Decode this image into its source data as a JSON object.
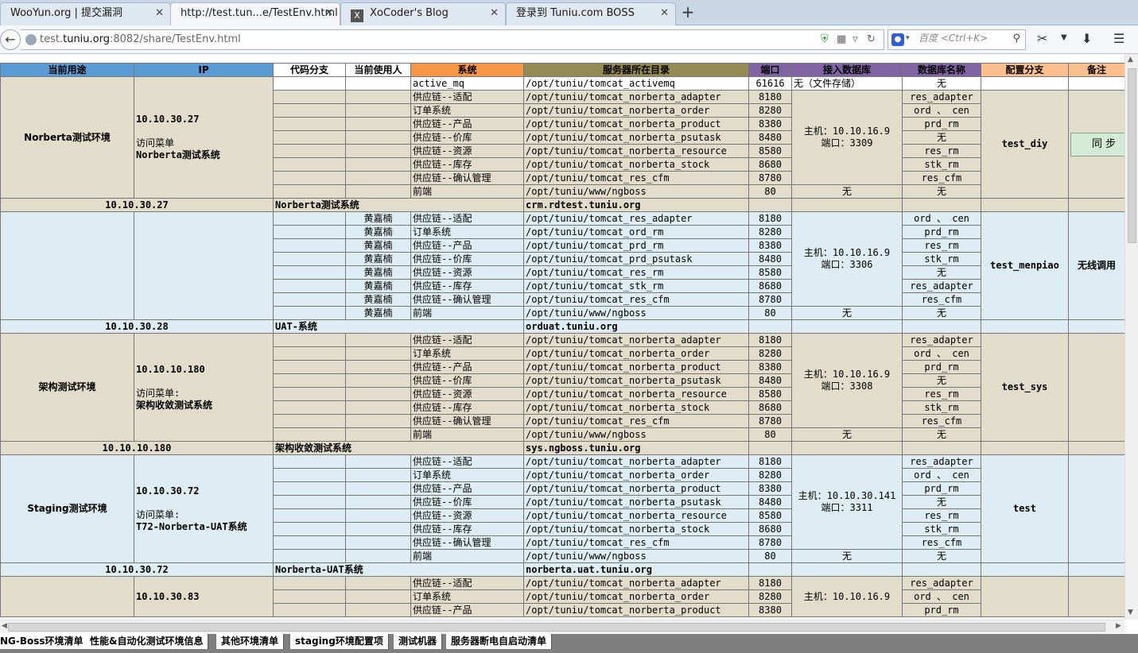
{
  "browser": {
    "tabs": [
      {
        "label": "WooYun.org | 提交漏洞"
      },
      {
        "label": "http://test.tun...e/TestEnv.html"
      },
      {
        "label": "XoCoder's Blog"
      },
      {
        "label": "登录到 Tuniu.com BOSS"
      }
    ],
    "close_glyph": "✕",
    "new_tab_glyph": "+",
    "url_prefix": "test.",
    "url_domain": "tuniu.org",
    "url_rest": ":8082/share/TestEnv.html",
    "search_placeholder": "百度 <Ctrl+K>"
  },
  "sheet": {
    "headers": [
      "当前用途",
      "IP",
      "代码分支",
      "当前使用人",
      "系统",
      "服务器所在目录",
      "端口",
      "接入数据库",
      "数据库名称",
      "配置分支",
      "备注"
    ],
    "header_colors": [
      "#5b9bd5",
      "#5b9bd5",
      "#ffffff",
      "#ffffff",
      "#f79646",
      "#948a54",
      "#8064a2",
      "#8064a2",
      "#8064a2",
      "#fac090",
      "#fac090"
    ],
    "none": "无",
    "block1": {
      "env": "Norberta测试环境",
      "ip": "10.10.30.27",
      "menu_label": "访问菜单",
      "menu_value": "Norberta测试系统",
      "rows": [
        [
          "active_mq",
          "/opt/tuniu/tomcat_activemq",
          "61616",
          "无（文件存储）",
          "无"
        ],
        [
          "供应链--适配",
          "/opt/tuniu/tomcat_norberta_adapter",
          "8180",
          "",
          "res_adapter"
        ],
        [
          "订单系统",
          "/opt/tuniu/tomcat_norberta_order",
          "8280",
          "",
          "ord 、 cen"
        ],
        [
          "供应链--产品",
          "/opt/tuniu/tomcat_norberta_product",
          "8380",
          "",
          "prd_rm"
        ],
        [
          "供应链--价库",
          "/opt/tuniu/tomcat_norberta_psutask",
          "8480",
          "",
          "无"
        ],
        [
          "供应链--资源",
          "/opt/tuniu/tomcat_norberta_resource",
          "8580",
          "",
          "res_rm"
        ],
        [
          "供应链--库存",
          "/opt/tuniu/tomcat_norberta_stock",
          "8680",
          "",
          "stk_rm"
        ],
        [
          "供应链--确认管理",
          "/opt/tuniu/tomcat_res_cfm",
          "8780",
          "",
          "res_cfm"
        ],
        [
          "前端",
          "/opt/tuniu/www/ngboss",
          "80",
          "无",
          "无"
        ]
      ],
      "db_host": "主机：10.10.16.9",
      "db_port": "端口：3309",
      "config": "test_diy",
      "sync": "同  步",
      "summary": [
        "10.10.30.27",
        "Norberta测试系统",
        "crm.rdtest.tuniu.org"
      ]
    },
    "block2": {
      "user": "黄嘉楠",
      "rows": [
        [
          "供应链--适配",
          "/opt/tuniu/tomcat_res_adapter",
          "8180",
          "ord 、 cen"
        ],
        [
          "订单系统",
          "/opt/tuniu/tomcat_ord_rm",
          "8280",
          "prd_rm"
        ],
        [
          "供应链--产品",
          "/opt/tuniu/tomcat_prd_rm",
          "8380",
          "res_rm"
        ],
        [
          "供应链--价库",
          "/opt/tuniu/tomcat_prd_psutask",
          "8480",
          "stk_rm"
        ],
        [
          "供应链--资源",
          "/opt/tuniu/tomcat_res_rm",
          "8580",
          "无"
        ],
        [
          "供应链--库存",
          "/opt/tuniu/tomcat_stk_rm",
          "8680",
          "res_adapter"
        ],
        [
          "供应链--确认管理",
          "/opt/tuniu/tomcat_res_cfm",
          "8780",
          "res_cfm"
        ],
        [
          "前端",
          "/opt/tuniu/www/ngboss",
          "80",
          "无"
        ]
      ],
      "db_host": "主机：10.10.16.9",
      "db_port": "端口：3306",
      "db_last": "无",
      "config": "test_menpiao",
      "note": "无线调用",
      "summary": [
        "10.10.30.28",
        "UAT-系统",
        "orduat.tuniu.org"
      ]
    },
    "block3": {
      "env": "架构测试环境",
      "ip": "10.10.10.180",
      "menu_label": "访问菜单:",
      "menu_value": "架构收敛测试系统",
      "db_host": "主机：10.10.16.9",
      "db_port": "端口：3308",
      "config": "test_sys",
      "summary": [
        "10.10.10.180",
        "架构收敛测试系统",
        "sys.ngboss.tuniu.org"
      ]
    },
    "block4": {
      "env": "Staging测试环境",
      "ip": "10.10.30.72",
      "menu_label": "访问菜单:",
      "menu_value": "T72-Norberta-UAT系统",
      "db_host": "主机：10.10.30.141",
      "db_port": "端口：3311",
      "config": "test",
      "summary": [
        "10.10.30.72",
        "Norberta-UAT系统",
        "norberta.uat.tuniu.org"
      ]
    },
    "std_rows": [
      [
        "供应链--适配",
        "/opt/tuniu/tomcat_norberta_adapter",
        "8180",
        "res_adapter"
      ],
      [
        "订单系统",
        "/opt/tuniu/tomcat_norberta_order",
        "8280",
        "ord 、 cen"
      ],
      [
        "供应链--产品",
        "/opt/tuniu/tomcat_norberta_product",
        "8380",
        "prd_rm"
      ],
      [
        "供应链--价库",
        "/opt/tuniu/tomcat_norberta_psutask",
        "8480",
        "无"
      ],
      [
        "供应链--资源",
        "/opt/tuniu/tomcat_norberta_resource",
        "8580",
        "res_rm"
      ],
      [
        "供应链--库存",
        "/opt/tuniu/tomcat_norberta_stock",
        "8680",
        "stk_rm"
      ],
      [
        "供应链--确认管理",
        "/opt/tuniu/tomcat_res_cfm",
        "8780",
        "res_cfm"
      ],
      [
        "前端",
        "/opt/tuniu/www/ngboss",
        "80",
        "无"
      ]
    ],
    "block5": {
      "ip": "10.10.30.83",
      "db_host": "主机：10.10.16.9",
      "rows": [
        [
          "供应链--适配",
          "/opt/tuniu/tomcat_norberta_adapter",
          "8180",
          "res_adapter"
        ],
        [
          "订单系统",
          "/opt/tuniu/tomcat_norberta_order",
          "8280",
          "ord 、 cen"
        ],
        [
          "供应链--产品",
          "/opt/tuniu/tomcat_norberta_product",
          "8380",
          "prd_rm"
        ]
      ]
    }
  },
  "sheet_tabs": [
    "NG-Boss环境清单",
    "性能&自动化测试环境信息",
    "其他环境清单",
    "staging环境配置项",
    "测试机器",
    "服务器断电自启动清单"
  ]
}
